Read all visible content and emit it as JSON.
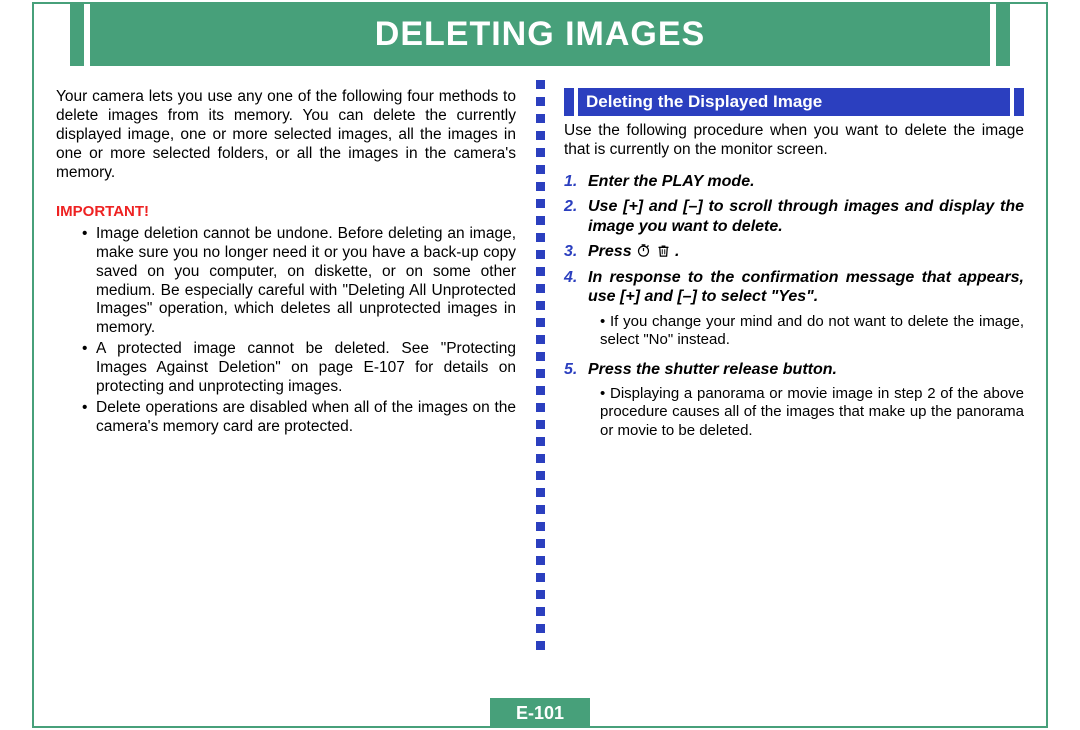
{
  "page_title": "DELETING IMAGES",
  "page_number": "E-101",
  "left": {
    "intro": "Your camera lets you use any one of the following four methods to delete images from its memory. You can delete the currently displayed image, one or more selected images, all the images in one or more selected folders, or all the images in the camera's memory.",
    "important_label": "IMPORTANT!",
    "bullets": [
      "Image deletion cannot be undone. Before deleting an image, make sure you no longer need it or you have a back-up copy saved on you computer, on diskette, or on some other medium. Be especially careful with \"Deleting All Unprotected Images\" operation, which deletes all unprotected images in memory.",
      "A protected image cannot be deleted. See \"Protecting Images Against Deletion\" on page E-107 for details on protecting and unprotecting images.",
      "Delete operations are disabled when all of the images on the camera's memory card are protected."
    ]
  },
  "right": {
    "section_title": "Deleting the Displayed Image",
    "section_intro": "Use the following procedure when you want to delete the image that is currently on the monitor screen.",
    "steps": [
      {
        "n": "1.",
        "text": "Enter the PLAY mode."
      },
      {
        "n": "2.",
        "text": "Use [+] and [–] to scroll through images and display the image you want to delete."
      },
      {
        "n": "3.",
        "text_prefix": "Press ",
        "has_icons": true,
        "text_suffix": " ."
      },
      {
        "n": "4.",
        "text": "In response to the confirmation message that appears, use [+] and [–] to select \"Yes\"."
      },
      {
        "n": "5.",
        "text": "Press the shutter release button."
      }
    ],
    "note_after_4": "If you change your mind and do not want to delete the image, select \"No\" instead.",
    "note_after_5": "Displaying a panorama or movie image in step 2 of the above procedure causes all of the images that make up the panorama or movie to be deleted."
  }
}
